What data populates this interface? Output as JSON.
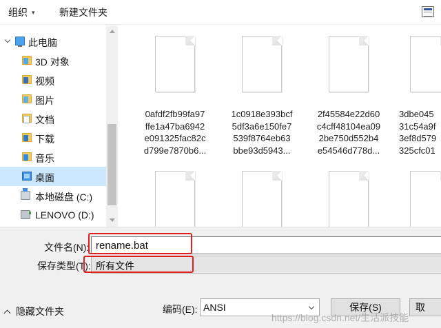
{
  "toolbar": {
    "organize_label": "组织",
    "organize_caret": "▾",
    "new_folder_label": "新建文件夹"
  },
  "nav": {
    "items": [
      {
        "label": "此电脑",
        "icon": "computer-icon"
      },
      {
        "label": "3D 对象",
        "icon": "3d-objects-folder-icon"
      },
      {
        "label": "视频",
        "icon": "videos-folder-icon"
      },
      {
        "label": "图片",
        "icon": "pictures-folder-icon"
      },
      {
        "label": "文档",
        "icon": "documents-folder-icon"
      },
      {
        "label": "下载",
        "icon": "downloads-folder-icon"
      },
      {
        "label": "音乐",
        "icon": "music-folder-icon"
      },
      {
        "label": "桌面",
        "icon": "desktop-folder-icon",
        "selected": true
      },
      {
        "label": "本地磁盘 (C:)",
        "icon": "local-disk-icon"
      },
      {
        "label": "LENOVO (D:)",
        "icon": "usb-drive-icon"
      }
    ]
  },
  "files": [
    {
      "name": "0afdf2fb99fa97ffe1a47ba6942e091325fac82cd799e7870b6..."
    },
    {
      "name": "1c0918e393bcf5df3a6e150fe7539f8764eb63bbe93d5943..."
    },
    {
      "name": "2f45584e22d60c4cff48104ea092be750d552b4e54546d778d..."
    },
    {
      "name": "3dbe04531c54a9f3ef8d579325cfc01"
    },
    {
      "name": ""
    },
    {
      "name": ""
    },
    {
      "name": ""
    },
    {
      "name": ""
    }
  ],
  "file_lines": [
    [
      "0afdf2fb99fa97",
      "ffe1a47ba6942",
      "e091325fac82c",
      "d799e7870b6..."
    ],
    [
      "1c0918e393bcf",
      "5df3a6e150fe7",
      "539f8764eb63",
      "bbe93d5943..."
    ],
    [
      "2f45584e22d60",
      "c4cff48104ea09",
      "2be750d552b4",
      "e54546d778d..."
    ],
    [
      "3dbe045",
      "31c54a9f",
      "3ef8d579",
      "325cfc01"
    ]
  ],
  "form": {
    "filename_label": "文件名(N):",
    "filename_value": "rename.bat",
    "filetype_label": "保存类型(T):",
    "filetype_value": "所有文件",
    "hide_folders_label": "隐藏文件夹",
    "encoding_label": "编码(E):",
    "encoding_value": "ANSI",
    "save_label": "保存(S)",
    "cancel_label": "取"
  },
  "watermark": "https://blog.csdn.net/生活派技能",
  "colors": {
    "selection": "#cce8ff",
    "highlight_box": "#e02020",
    "form_bg": "#f0f0f0"
  }
}
